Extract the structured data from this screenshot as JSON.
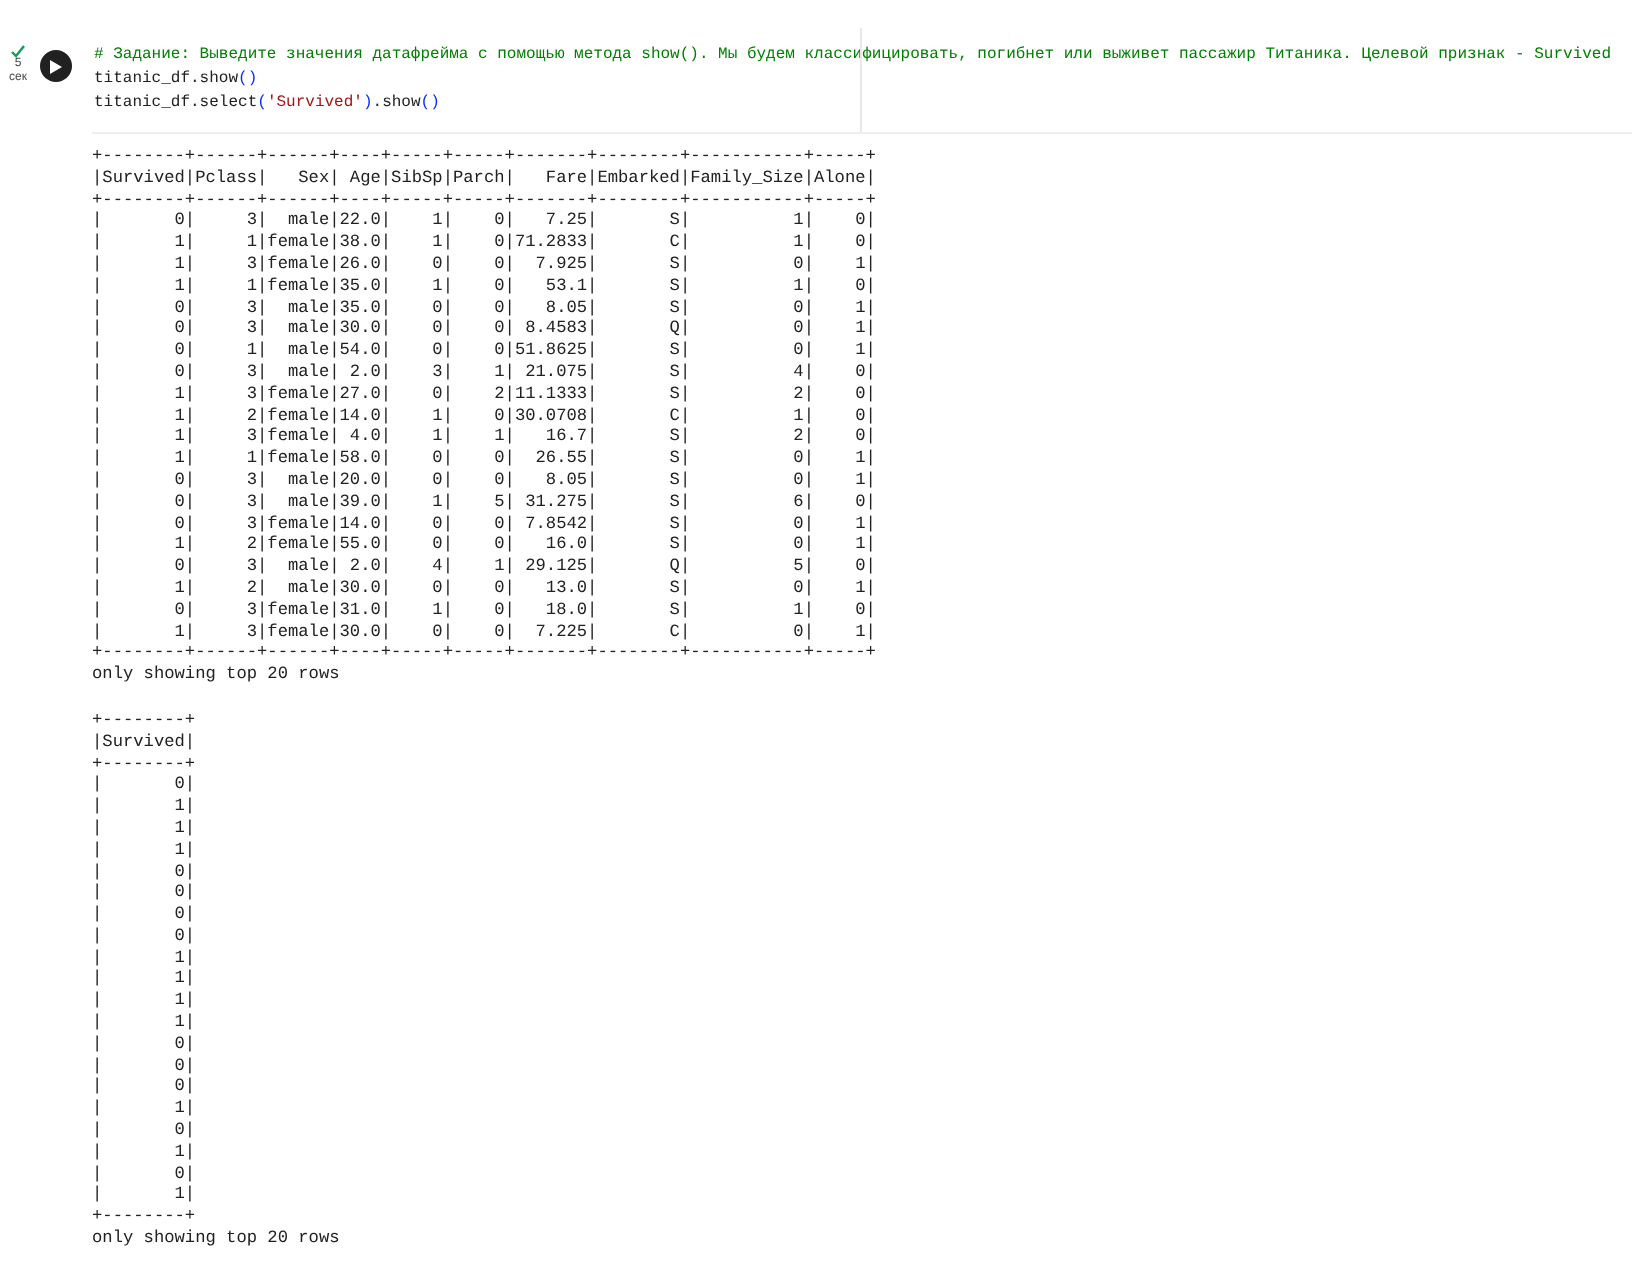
{
  "cell": {
    "status": {
      "done": true,
      "time": "5",
      "unit": "сек"
    },
    "code": [
      [
        {
          "kind": "comment",
          "text": "# Задание: Выведите значения датафрейма с помощью метода show(). Мы будем классифицировать, погибнет или выживет пассажир Титаника. Целевой признак - Survived"
        }
      ],
      [
        {
          "kind": "plain",
          "text": "titanic_df.show"
        },
        {
          "kind": "paren",
          "text": "()"
        }
      ],
      [
        {
          "kind": "plain",
          "text": "titanic_df.select"
        },
        {
          "kind": "paren",
          "text": "("
        },
        {
          "kind": "string",
          "text": "'Survived'"
        },
        {
          "kind": "paren",
          "text": ")"
        },
        {
          "kind": "plain",
          "text": ".show"
        },
        {
          "kind": "paren",
          "text": "()"
        }
      ]
    ],
    "outputs": [
      {
        "lines": [
          "+--------+------+------+----+-----+-----+-------+--------+-----------+-----+",
          "|Survived|Pclass|   Sex| Age|SibSp|Parch|   Fare|Embarked|Family_Size|Alone|",
          "+--------+------+------+----+-----+-----+-------+--------+-----------+-----+",
          "|       0|     3|  male|22.0|    1|    0|   7.25|       S|          1|    0|",
          "|       1|     1|female|38.0|    1|    0|71.2833|       C|          1|    0|",
          "|       1|     3|female|26.0|    0|    0|  7.925|       S|          0|    1|",
          "|       1|     1|female|35.0|    1|    0|   53.1|       S|          1|    0|",
          "|       0|     3|  male|35.0|    0|    0|   8.05|       S|          0|    1|",
          "|       0|     3|  male|30.0|    0|    0| 8.4583|       Q|          0|    1|",
          "|       0|     1|  male|54.0|    0|    0|51.8625|       S|          0|    1|",
          "|       0|     3|  male| 2.0|    3|    1| 21.075|       S|          4|    0|",
          "|       1|     3|female|27.0|    0|    2|11.1333|       S|          2|    0|",
          "|       1|     2|female|14.0|    1|    0|30.0708|       C|          1|    0|",
          "|       1|     3|female| 4.0|    1|    1|   16.7|       S|          2|    0|",
          "|       1|     1|female|58.0|    0|    0|  26.55|       S|          0|    1|",
          "|       0|     3|  male|20.0|    0|    0|   8.05|       S|          0|    1|",
          "|       0|     3|  male|39.0|    1|    5| 31.275|       S|          6|    0|",
          "|       0|     3|female|14.0|    0|    0| 7.8542|       S|          0|    1|",
          "|       1|     2|female|55.0|    0|    0|   16.0|       S|          0|    1|",
          "|       0|     3|  male| 2.0|    4|    1| 29.125|       Q|          5|    0|",
          "|       1|     2|  male|30.0|    0|    0|   13.0|       S|          0|    1|",
          "|       0|     3|female|31.0|    1|    0|   18.0|       S|          1|    0|",
          "|       1|     3|female|30.0|    0|    0|  7.225|       C|          0|    1|",
          "+--------+------+------+----+-----+-----+-------+--------+-----------+-----+",
          "only showing top 20 rows"
        ]
      },
      {
        "lines": [
          "+--------+",
          "|Survived|",
          "+--------+",
          "|       0|",
          "|       1|",
          "|       1|",
          "|       1|",
          "|       0|",
          "|       0|",
          "|       0|",
          "|       0|",
          "|       1|",
          "|       1|",
          "|       1|",
          "|       1|",
          "|       0|",
          "|       0|",
          "|       0|",
          "|       1|",
          "|       0|",
          "|       1|",
          "|       0|",
          "|       1|",
          "+--------+",
          "only showing top 20 rows"
        ]
      }
    ]
  }
}
